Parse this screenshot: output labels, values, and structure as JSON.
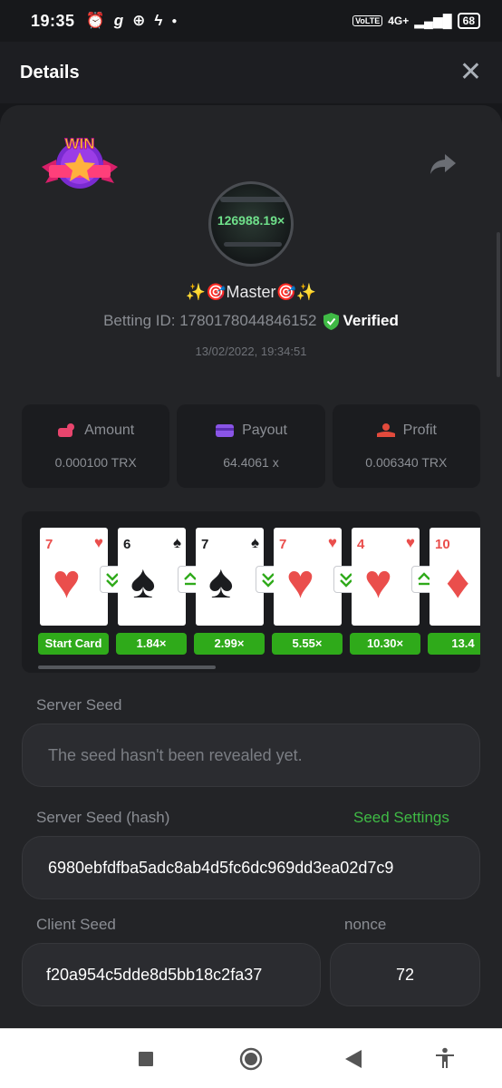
{
  "status_bar": {
    "time": "19:35",
    "battery": "68",
    "network": "4G+"
  },
  "header": {
    "title": "Details"
  },
  "profile": {
    "badge_text": "WIN",
    "avatar_multiplier": "126988.19×",
    "name": "✨🎯Master🎯✨",
    "betting_id": "Betting ID: 1780178044846152",
    "verified": "Verified",
    "date": "13/02/2022, 19:34:51"
  },
  "stats": [
    {
      "label": "Amount",
      "value": "0.000100 TRX",
      "icon": "amount-icon"
    },
    {
      "label": "Payout",
      "value": "64.4061 x",
      "icon": "payout-card-icon"
    },
    {
      "label": "Profit",
      "value": "0.006340 TRX",
      "icon": "profit-icon"
    }
  ],
  "cards": [
    {
      "rank": "7",
      "suit": "♥",
      "color": "red",
      "multiplier": "Start Card"
    },
    {
      "rank": "6",
      "suit": "♠",
      "color": "black",
      "multiplier": "1.84×",
      "guess": "lower"
    },
    {
      "rank": "7",
      "suit": "♠",
      "color": "black",
      "multiplier": "2.99×",
      "guess": "higher"
    },
    {
      "rank": "7",
      "suit": "♥",
      "color": "red",
      "multiplier": "5.55×",
      "guess": "lower"
    },
    {
      "rank": "4",
      "suit": "♥",
      "color": "red",
      "multiplier": "10.30×",
      "guess": "lower"
    },
    {
      "rank": "10",
      "suit": "♦",
      "color": "red",
      "multiplier": "13.4",
      "guess": "higher"
    }
  ],
  "server_seed": {
    "label": "Server Seed",
    "value": "The seed hasn't been revealed yet."
  },
  "server_seed_hash": {
    "label": "Server Seed (hash)",
    "link": "Seed Settings",
    "value": "6980ebfdfba5adc8ab4d5fc6dc969dd3ea02d7c9"
  },
  "client_seed": {
    "label": "Client Seed",
    "value": "f20a954c5dde8d5bb18c2fa37"
  },
  "nonce": {
    "label": "nonce",
    "value": "72"
  },
  "colors": {
    "accent_green": "#3fba45",
    "multiplier_green": "#2faa1a",
    "background": "#232427"
  }
}
